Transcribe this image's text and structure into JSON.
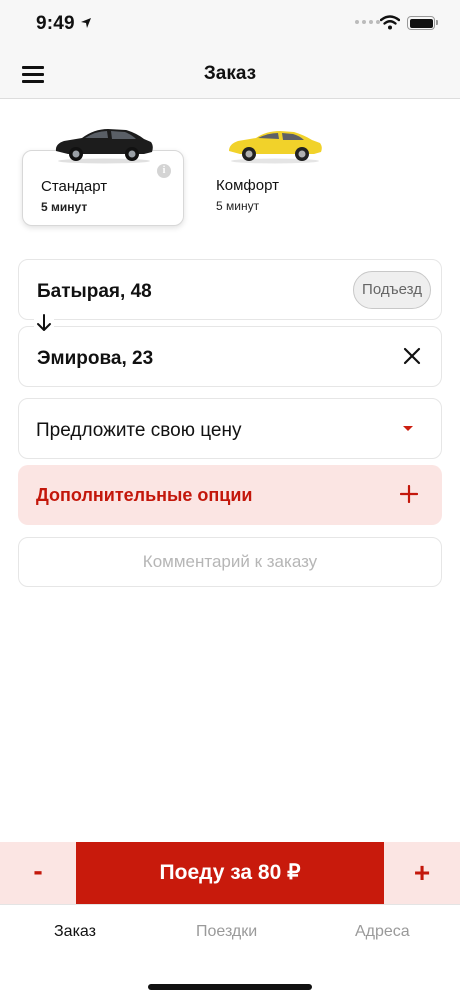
{
  "status_bar": {
    "time": "9:49"
  },
  "header": {
    "title": "Заказ"
  },
  "tariffs": [
    {
      "name": "Стандарт",
      "eta": "5 минут",
      "selected": true,
      "car_color": "#1a1a1a"
    },
    {
      "name": "Комфорт",
      "eta": "5 минут",
      "selected": false,
      "car_color": "#f1d22a"
    }
  ],
  "route": {
    "from": "Батырая, 48",
    "entrance_label": "Подъезд",
    "to": "Эмирова, 23"
  },
  "price": {
    "label": "Предложите свою цену"
  },
  "options": {
    "label": "Дополнительные опции"
  },
  "comment": {
    "placeholder": "Комментарий к заказу",
    "value": ""
  },
  "order_bar": {
    "decrease": "-",
    "order_label": "Поеду за 80 ₽",
    "increase": "+"
  },
  "tabs": [
    {
      "label": "Заказ",
      "active": true
    },
    {
      "label": "Поездки",
      "active": false
    },
    {
      "label": "Адреса",
      "active": false
    }
  ],
  "colors": {
    "accent": "#c81a0c",
    "accent_light": "#fbe5e3",
    "inactive_tab": "#9a9a9a"
  }
}
